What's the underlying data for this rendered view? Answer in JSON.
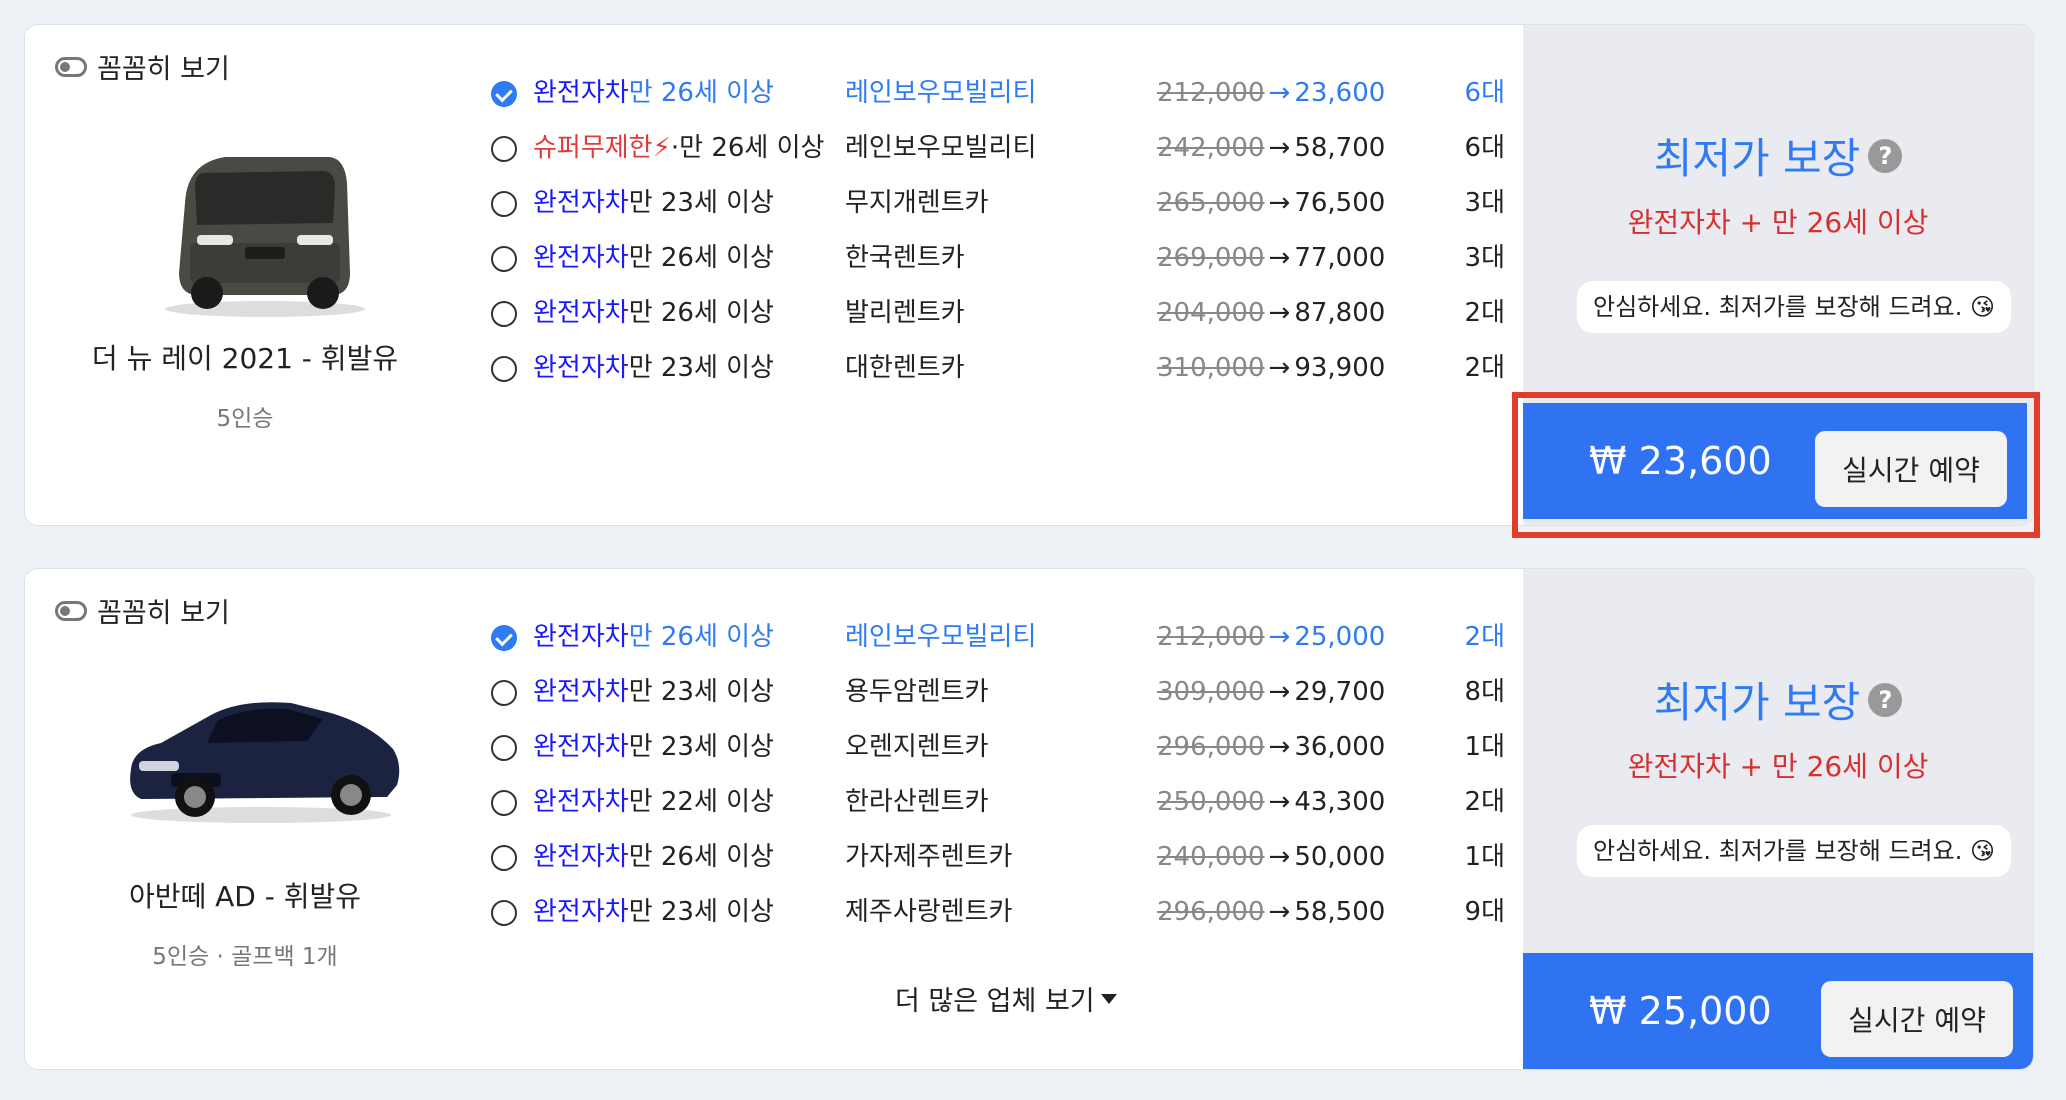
{
  "listings": [
    {
      "detail_toggle": "꼼꼼히 보기",
      "car_name": "더 뉴 레이 2021 - 휘발유",
      "car_spec": "5인승",
      "car_image": "boxy-minivan-dark-gray",
      "rows": [
        {
          "tag": "완전자차",
          "age": "만 26세 이상",
          "company": "레인보우모빌리티",
          "orig": "212,000",
          "price": "23,600",
          "count": "6대",
          "selected": true
        },
        {
          "tag": "슈퍼무제한",
          "bolt": "⚡",
          "age": "·만 26세 이상",
          "company": "레인보우모빌리티",
          "orig": "242,000",
          "price": "58,700",
          "count": "6대",
          "super": true
        },
        {
          "tag": "완전자차",
          "age": "만 23세 이상",
          "company": "무지개렌트카",
          "orig": "265,000",
          "price": "76,500",
          "count": "3대"
        },
        {
          "tag": "완전자차",
          "age": "만 26세 이상",
          "company": "한국렌트카",
          "orig": "269,000",
          "price": "77,000",
          "count": "3대"
        },
        {
          "tag": "완전자차",
          "age": "만 26세 이상",
          "company": "발리렌트카",
          "orig": "204,000",
          "price": "87,800",
          "count": "2대"
        },
        {
          "tag": "완전자차",
          "age": "만 23세 이상",
          "company": "대한렌트카",
          "orig": "310,000",
          "price": "93,900",
          "count": "2대"
        }
      ],
      "guarantee": "최저가 보장",
      "guarantee_cond": "완전자차 + 만 26세 이상",
      "reassure": "안심하세요. 최저가를 보장해 드려요. 😘",
      "pay_amount": "₩ 23,600",
      "reserve_label": "실시간 예약"
    },
    {
      "detail_toggle": "꼼꼼히 보기",
      "car_name": "아반떼 AD - 휘발유",
      "car_spec": "5인승 · 골프백 1개",
      "car_image": "sedan-navy",
      "rows": [
        {
          "tag": "완전자차",
          "age": "만 26세 이상",
          "company": "레인보우모빌리티",
          "orig": "212,000",
          "price": "25,000",
          "count": "2대",
          "selected": true
        },
        {
          "tag": "완전자차",
          "age": "만 23세 이상",
          "company": "용두암렌트카",
          "orig": "309,000",
          "price": "29,700",
          "count": "8대"
        },
        {
          "tag": "완전자차",
          "age": "만 23세 이상",
          "company": "오렌지렌트카",
          "orig": "296,000",
          "price": "36,000",
          "count": "1대"
        },
        {
          "tag": "완전자차",
          "age": "만 22세 이상",
          "company": "한라산렌트카",
          "orig": "250,000",
          "price": "43,300",
          "count": "2대"
        },
        {
          "tag": "완전자차",
          "age": "만 26세 이상",
          "company": "가자제주렌트카",
          "orig": "240,000",
          "price": "50,000",
          "count": "1대"
        },
        {
          "tag": "완전자차",
          "age": "만 23세 이상",
          "company": "제주사랑렌트카",
          "orig": "296,000",
          "price": "58,500",
          "count": "9대"
        }
      ],
      "more_label": "더 많은 업체 보기",
      "guarantee": "최저가 보장",
      "guarantee_cond": "완전자차 + 만 26세 이상",
      "reassure": "안심하세요. 최저가를 보장해 드려요. 😘",
      "pay_amount": "₩ 25,000",
      "reserve_label": "실시간 예약"
    }
  ],
  "colors": {
    "accent": "#2f7bf5",
    "pay_bar": "#2f73f3",
    "warning_red": "#d83030",
    "insurance_blue": "#1a1aff",
    "highlight_red": "#e23c2a"
  }
}
